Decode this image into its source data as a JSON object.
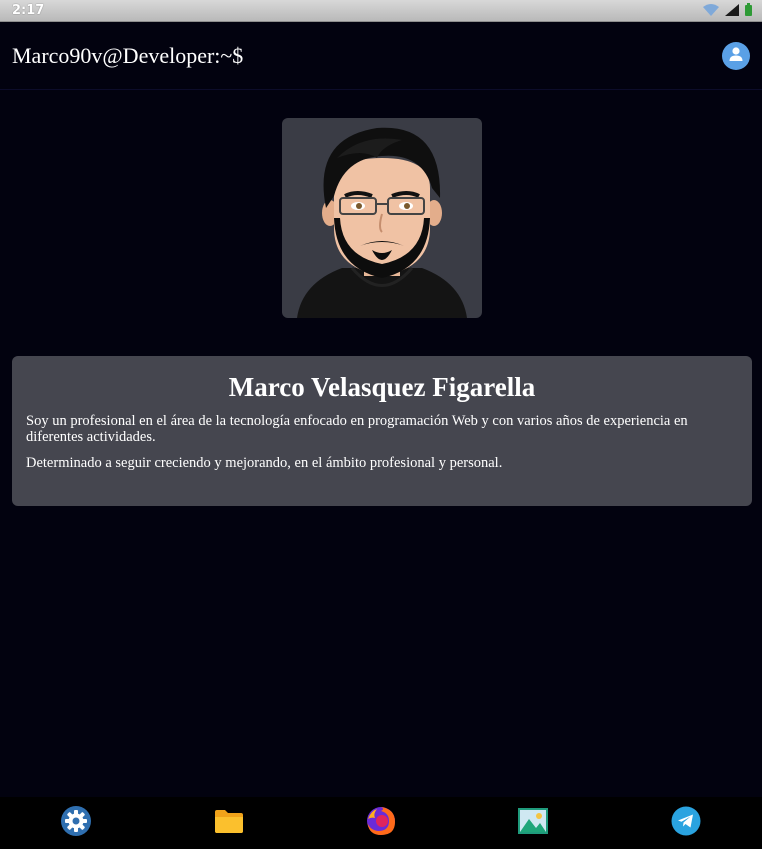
{
  "status_bar": {
    "time": "2:17",
    "icons": [
      "wifi-icon",
      "signal-icon",
      "battery-icon"
    ]
  },
  "header": {
    "title": "Marco90v@Developer:~$",
    "user_icon": "user-icon"
  },
  "profile": {
    "name": "Marco Velasquez Figarella",
    "paragraphs": [
      "Soy un profesional en el área de la tecnología enfocado en programación Web y con varios años de experiencia en diferentes actividades.",
      "Determinado a seguir creciendo y mejorando, en el ámbito profesional y personal."
    ]
  },
  "dock": {
    "items": [
      "settings-icon",
      "folder-icon",
      "firefox-icon",
      "gallery-icon",
      "telegram-icon"
    ]
  },
  "colors": {
    "background": "#02020f",
    "card": "#45464f",
    "accent_blue": "#5aa0e6"
  }
}
